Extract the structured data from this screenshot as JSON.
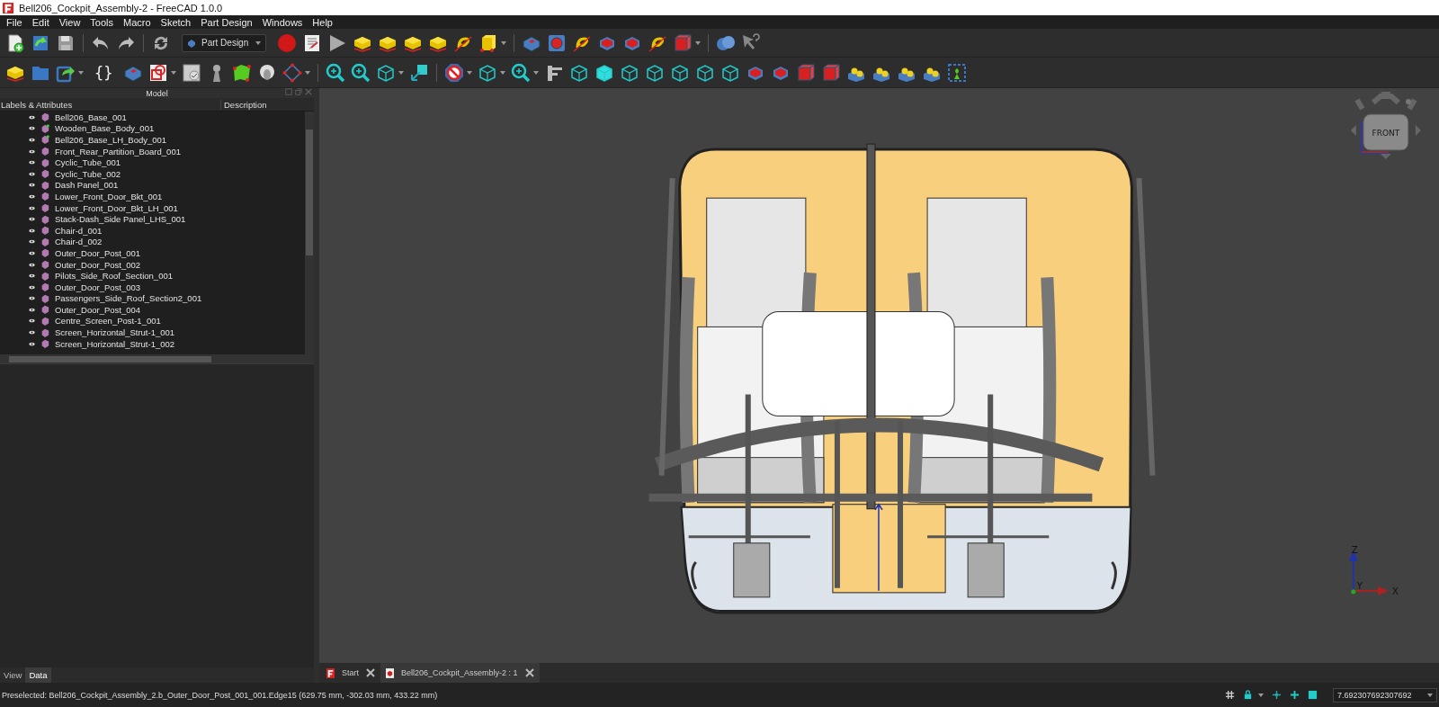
{
  "window": {
    "title": "Bell206_Cockpit_Assembly-2 - FreeCAD 1.0.0"
  },
  "menu": [
    "File",
    "Edit",
    "View",
    "Tools",
    "Macro",
    "Sketch",
    "Part Design",
    "Windows",
    "Help"
  ],
  "toolbar": {
    "workbench": "Part Design",
    "braces_button": "{}"
  },
  "model_panel": {
    "title": "Model",
    "columns": [
      "Labels & Attributes",
      "Description"
    ],
    "items": [
      {
        "label": "Bell206_Base_001",
        "marked": false
      },
      {
        "label": "Wooden_Base_Body_001",
        "marked": true
      },
      {
        "label": "Bell206_Base_LH_Body_001",
        "marked": true
      },
      {
        "label": "Front_Rear_Partition_Board_001",
        "marked": false
      },
      {
        "label": "Cyclic_Tube_001",
        "marked": false
      },
      {
        "label": "Cyclic_Tube_002",
        "marked": false
      },
      {
        "label": "Dash Panel_001",
        "marked": false
      },
      {
        "label": "Lower_Front_Door_Bkt_001",
        "marked": false
      },
      {
        "label": "Lower_Front_Door_Bkt_LH_001",
        "marked": false
      },
      {
        "label": "Stack-Dash_Side Panel_LHS_001",
        "marked": false
      },
      {
        "label": "Chair-d_001",
        "marked": false
      },
      {
        "label": "Chair-d_002",
        "marked": false
      },
      {
        "label": "Outer_Door_Post_001",
        "marked": false
      },
      {
        "label": "Outer_Door_Post_002",
        "marked": false
      },
      {
        "label": "Pilots_Side_Roof_Section_001",
        "marked": false
      },
      {
        "label": "Outer_Door_Post_003",
        "marked": false
      },
      {
        "label": "Passengers_Side_Roof_Section2_001",
        "marked": false
      },
      {
        "label": "Outer_Door_Post_004",
        "marked": false
      },
      {
        "label": "Centre_Screen_Post-1_001",
        "marked": false
      },
      {
        "label": "Screen_Horizontal_Strut-1_001",
        "marked": false
      },
      {
        "label": "Screen_Horizontal_Strut-1_002",
        "marked": false
      }
    ]
  },
  "panel_tabs": [
    {
      "label": "View",
      "selected": false
    },
    {
      "label": "Data",
      "selected": true
    }
  ],
  "view": {
    "navigation_cube": {
      "face": "FRONT"
    },
    "axes": [
      "Z",
      "Y",
      "X"
    ]
  },
  "document_tabs": [
    {
      "label": "Start",
      "selected": false
    },
    {
      "label": "Bell206_Cockpit_Assembly-2 : 1",
      "selected": true
    }
  ],
  "status_bar": {
    "message": "Preselected: Bell206_Cockpit_Assembly_2.b_Outer_Door_Post_001_001.Edge15 (629.75 mm, -302.03 mm, 433.22 mm)",
    "scale": "7.692307692307692"
  }
}
